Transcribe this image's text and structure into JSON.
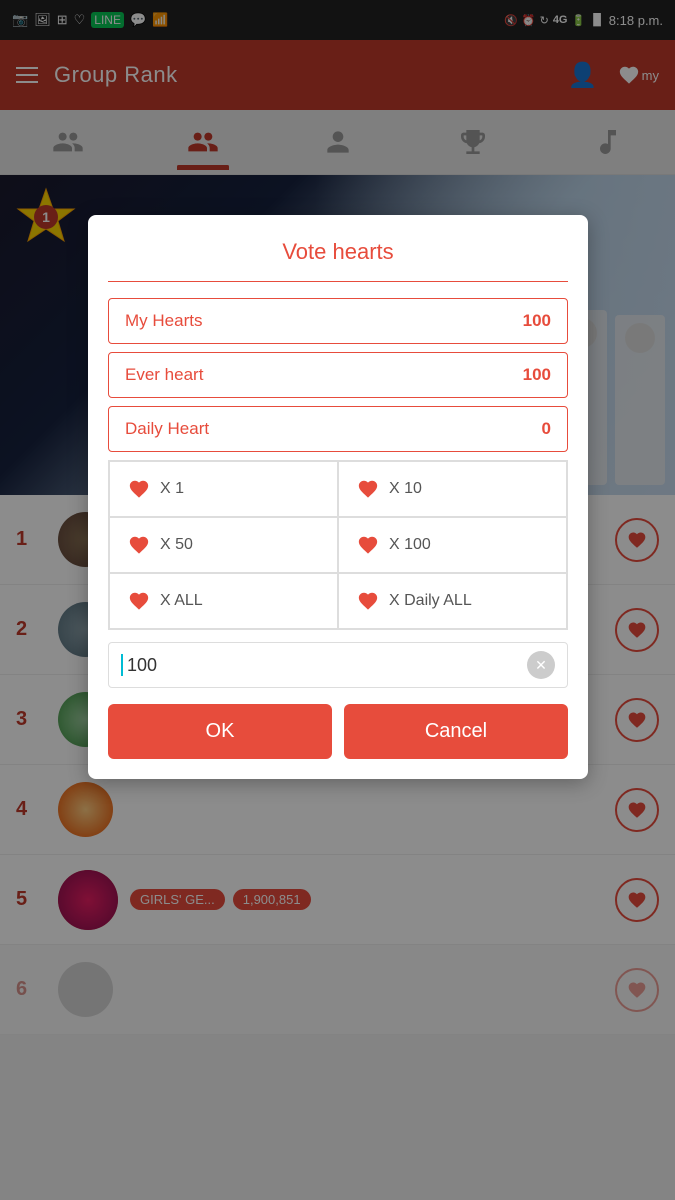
{
  "statusBar": {
    "time": "8:18 p.m.",
    "icons": [
      "instagram",
      "image",
      "grid",
      "heart",
      "line",
      "wechat",
      "wifi",
      "mute",
      "alarm",
      "refresh",
      "4g",
      "battery",
      "signal"
    ]
  },
  "header": {
    "title": "Group Rank",
    "menuIcon": "≡",
    "profileIcon": "👤",
    "heartIcon": "♡"
  },
  "navTabs": [
    {
      "id": "groups",
      "label": "Groups",
      "active": false
    },
    {
      "id": "idols",
      "label": "Idols",
      "active": true
    },
    {
      "id": "persons",
      "label": "Persons",
      "active": false
    },
    {
      "id": "trophy",
      "label": "Trophy",
      "active": false
    },
    {
      "id": "music",
      "label": "Music",
      "active": false
    }
  ],
  "dialog": {
    "title": "Vote hearts",
    "rows": [
      {
        "label": "My Hearts",
        "value": "100"
      },
      {
        "label": "Ever heart",
        "value": "100"
      },
      {
        "label": "Daily Heart",
        "value": "0"
      }
    ],
    "voteOptions": [
      {
        "label": "X 1",
        "id": "x1"
      },
      {
        "label": "X 10",
        "id": "x10"
      },
      {
        "label": "X 50",
        "id": "x50"
      },
      {
        "label": "X 100",
        "id": "x100"
      },
      {
        "label": "X ALL",
        "id": "xall"
      },
      {
        "label": "X Daily ALL",
        "id": "xdailyall"
      }
    ],
    "inputValue": "100",
    "okLabel": "OK",
    "cancelLabel": "Cancel"
  },
  "rankList": [
    {
      "rank": "1",
      "name": "",
      "score": "",
      "hasScore": false
    },
    {
      "rank": "2",
      "name": "",
      "score": "",
      "hasScore": false
    },
    {
      "rank": "3",
      "name": "",
      "score": "",
      "hasScore": false
    },
    {
      "rank": "4",
      "name": "",
      "score": "",
      "hasScore": false
    },
    {
      "rank": "5",
      "name": "GIRLS' GE...",
      "score": "1,900,851",
      "hasScore": true
    }
  ]
}
